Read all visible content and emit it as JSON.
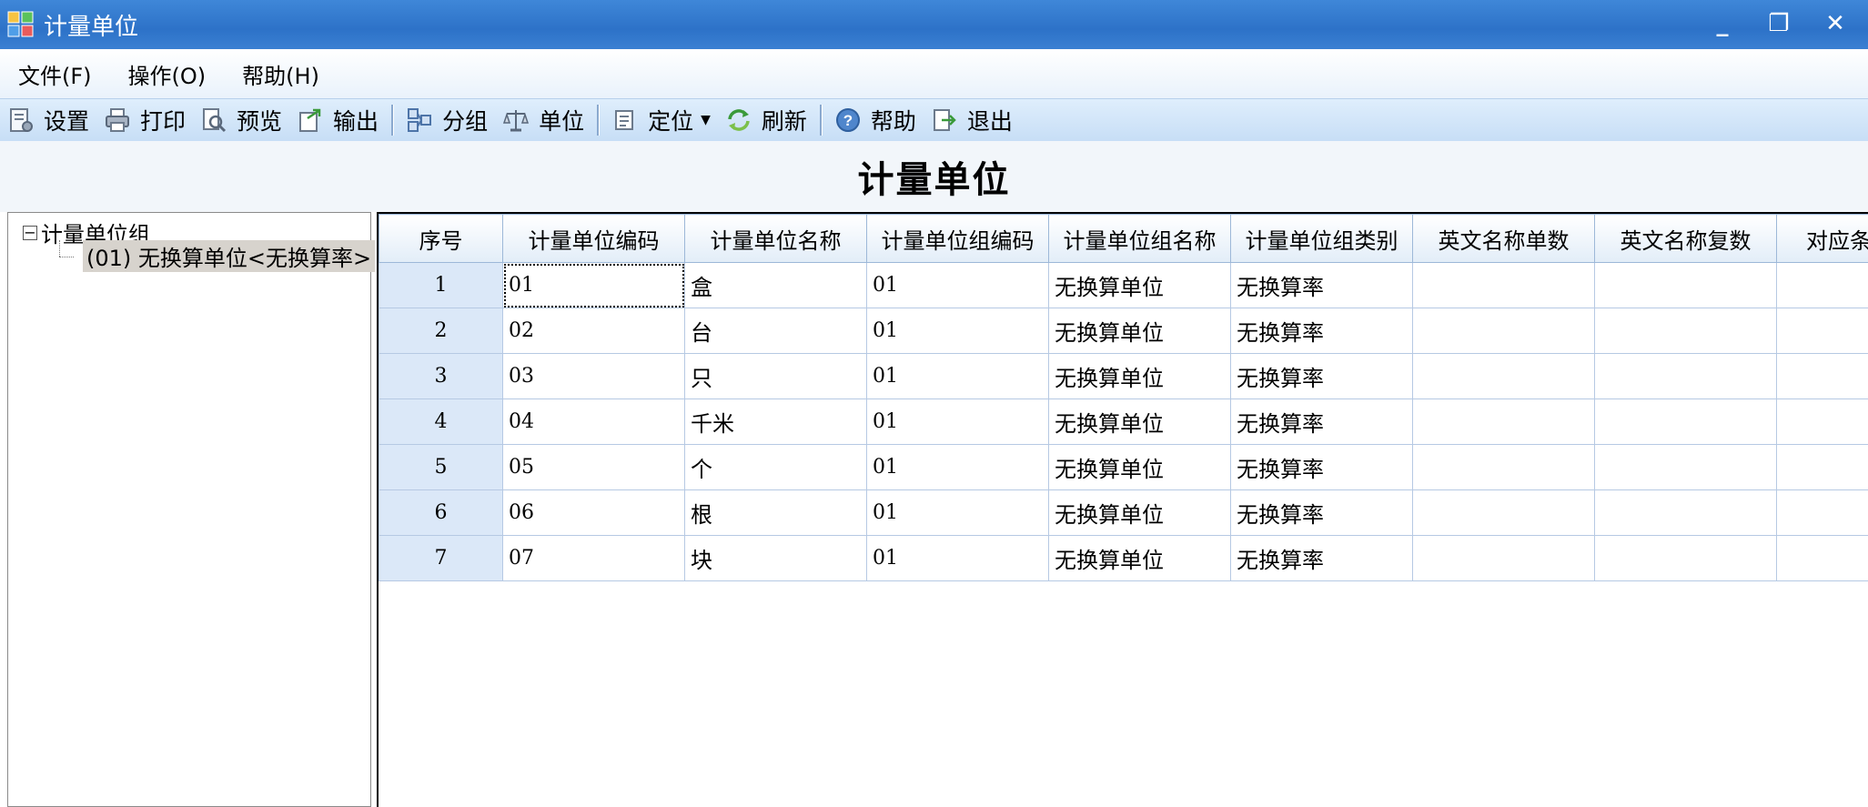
{
  "window": {
    "title": "计量单位",
    "controls": {
      "minimize": "_",
      "restore": "❐",
      "close": "✕"
    }
  },
  "menu": [
    {
      "label": "文件(F)"
    },
    {
      "label": "操作(O)"
    },
    {
      "label": "帮助(H)"
    }
  ],
  "toolbar": {
    "settings": "设置",
    "print": "打印",
    "preview": "预览",
    "export": "输出",
    "group": "分组",
    "unit": "单位",
    "locate": "定位",
    "refresh": "刷新",
    "help": "帮助",
    "exit": "退出"
  },
  "heading": "计量单位",
  "tree": {
    "root": "计量单位组",
    "toggle": "−",
    "child": "(01) 无换算单位<无换算率>"
  },
  "grid": {
    "columns": [
      "序号",
      "计量单位编码",
      "计量单位名称",
      "计量单位组编码",
      "计量单位组名称",
      "计量单位组类别",
      "英文名称单数",
      "英文名称复数",
      "对应条"
    ],
    "rows": [
      [
        "1",
        "01",
        "盒",
        "01",
        "无换算单位",
        "无换算率",
        "",
        "",
        ""
      ],
      [
        "2",
        "02",
        "台",
        "01",
        "无换算单位",
        "无换算率",
        "",
        "",
        ""
      ],
      [
        "3",
        "03",
        "只",
        "01",
        "无换算单位",
        "无换算率",
        "",
        "",
        ""
      ],
      [
        "4",
        "04",
        "千米",
        "01",
        "无换算单位",
        "无换算率",
        "",
        "",
        ""
      ],
      [
        "5",
        "05",
        "个",
        "01",
        "无换算单位",
        "无换算率",
        "",
        "",
        ""
      ],
      [
        "6",
        "06",
        "根",
        "01",
        "无换算单位",
        "无换算率",
        "",
        "",
        ""
      ],
      [
        "7",
        "07",
        "块",
        "01",
        "无换算单位",
        "无换算率",
        "",
        "",
        ""
      ]
    ]
  },
  "colors": {
    "titlebar": "#2d72c8",
    "toolbar": "#c7def6",
    "index_cell": "#dbe8f8"
  }
}
